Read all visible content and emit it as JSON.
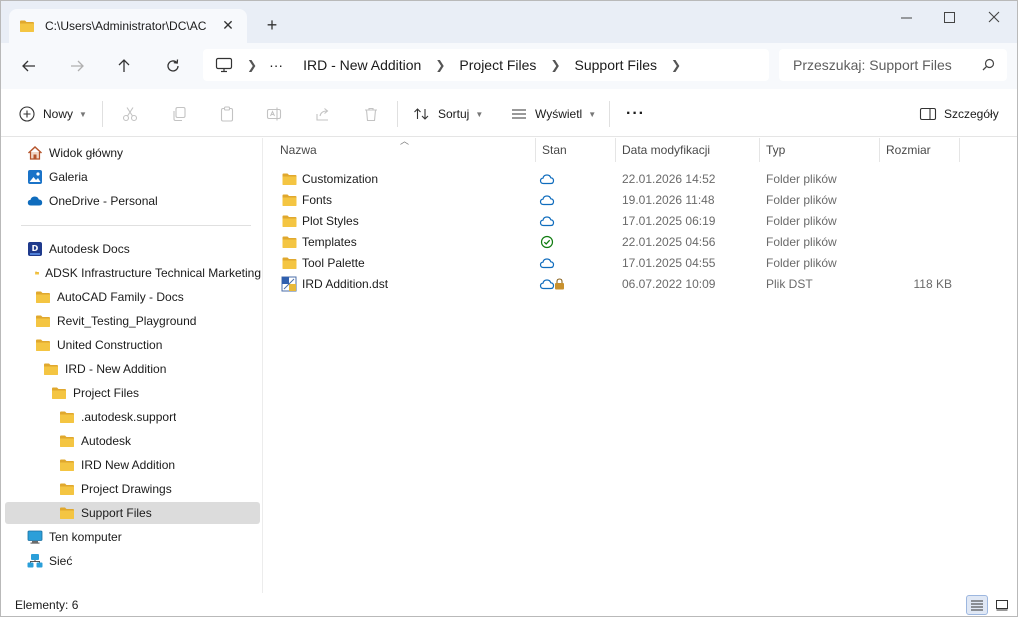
{
  "tab": {
    "title": "C:\\Users\\Administrator\\DC\\AC",
    "close": "✕",
    "new": "+"
  },
  "window_controls": {
    "minimize": "—",
    "maximize": "☐",
    "close": "✕"
  },
  "breadcrumb": {
    "more": "···",
    "segments": [
      "IRD - New Addition",
      "Project Files",
      "Support Files"
    ]
  },
  "search": {
    "placeholder": "Przeszukaj: Support Files"
  },
  "toolbar": {
    "new_label": "Nowy",
    "sort_label": "Sortuj",
    "view_label": "Wyświetl",
    "more_label": "···",
    "details_label": "Szczegóły"
  },
  "sidebar": {
    "items": [
      {
        "label": "Widok główny",
        "icon": "home-icon"
      },
      {
        "label": "Galeria",
        "icon": "gallery-icon"
      },
      {
        "label": "OneDrive - Personal",
        "icon": "cloud-icon"
      },
      {
        "label": "Autodesk Docs",
        "icon": "docs-icon"
      },
      {
        "label": "ADSK Infrastructure Technical Marketing",
        "icon": "folder-icon"
      },
      {
        "label": "AutoCAD Family - Docs",
        "icon": "folder-icon"
      },
      {
        "label": "Revit_Testing_Playground",
        "icon": "folder-icon"
      },
      {
        "label": "United Construction",
        "icon": "folder-icon"
      },
      {
        "label": "IRD - New Addition",
        "icon": "folder-icon"
      },
      {
        "label": "Project Files",
        "icon": "folder-icon"
      },
      {
        "label": ".autodesk.support",
        "icon": "folder-icon"
      },
      {
        "label": "Autodesk",
        "icon": "folder-icon"
      },
      {
        "label": "IRD New Addition",
        "icon": "folder-icon"
      },
      {
        "label": "Project Drawings",
        "icon": "folder-icon"
      },
      {
        "label": "Support Files",
        "icon": "folder-icon"
      },
      {
        "label": "Ten komputer",
        "icon": "computer-icon"
      },
      {
        "label": "Sieć",
        "icon": "network-icon"
      }
    ]
  },
  "columns": {
    "name": "Nazwa",
    "status": "Stan",
    "modified": "Data modyfikacji",
    "type": "Typ",
    "size": "Rozmiar"
  },
  "files": [
    {
      "name": "Customization",
      "status": "cloud",
      "modified": "22.01.2026 14:52",
      "type": "Folder plików",
      "size": ""
    },
    {
      "name": "Fonts",
      "status": "cloud",
      "modified": "19.01.2026 11:48",
      "type": "Folder plików",
      "size": ""
    },
    {
      "name": "Plot Styles",
      "status": "cloud",
      "modified": "17.01.2025 06:19",
      "type": "Folder plików",
      "size": ""
    },
    {
      "name": "Templates",
      "status": "synced",
      "modified": "22.01.2025 04:56",
      "type": "Folder plików",
      "size": ""
    },
    {
      "name": "Tool Palette",
      "status": "cloud",
      "modified": "17.01.2025 04:55",
      "type": "Folder plików",
      "size": ""
    },
    {
      "name": "IRD Addition.dst",
      "status": "cloud-locked",
      "modified": "06.07.2022 10:09",
      "type": "Plik DST",
      "size": "118 KB"
    }
  ],
  "status": {
    "items_text": "Elementy: 6"
  },
  "colors": {
    "folder": "#f4c542",
    "folder_dark": "#e0a82e",
    "cloud": "#0f6cbd",
    "synced": "#107c10",
    "selected": "#dcdcdc"
  }
}
